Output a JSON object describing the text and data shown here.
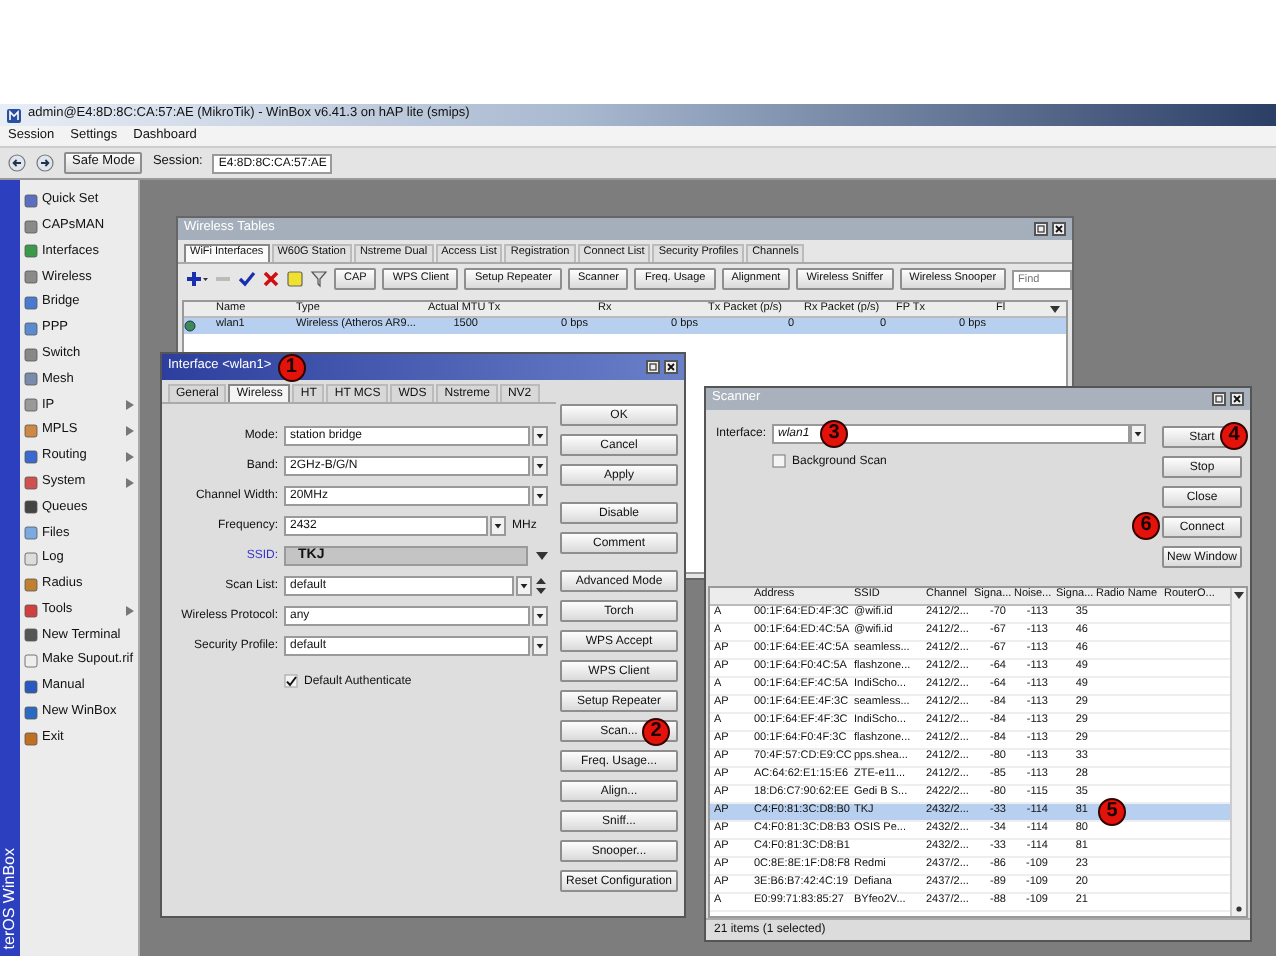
{
  "app_window": {
    "title": "admin@E4:8D:8C:CA:57:AE (MikroTik) - WinBox v6.41.3 on hAP lite (smips)"
  },
  "menu_bar": [
    "Session",
    "Settings",
    "Dashboard"
  ],
  "toolbar": {
    "safe_mode": "Safe Mode",
    "session_label": "Session:",
    "session_value": "E4:8D:8C:CA:57:AE"
  },
  "sidebar": {
    "brand": "terOS WinBox",
    "items": [
      {
        "label": "Quick Set",
        "submenu": false
      },
      {
        "label": "CAPsMAN",
        "submenu": false
      },
      {
        "label": "Interfaces",
        "submenu": false
      },
      {
        "label": "Wireless",
        "submenu": false
      },
      {
        "label": "Bridge",
        "submenu": false
      },
      {
        "label": "PPP",
        "submenu": false
      },
      {
        "label": "Switch",
        "submenu": false
      },
      {
        "label": "Mesh",
        "submenu": false
      },
      {
        "label": "IP",
        "submenu": true
      },
      {
        "label": "MPLS",
        "submenu": true
      },
      {
        "label": "Routing",
        "submenu": true
      },
      {
        "label": "System",
        "submenu": true
      },
      {
        "label": "Queues",
        "submenu": false
      },
      {
        "label": "Files",
        "submenu": false
      },
      {
        "label": "Log",
        "submenu": false
      },
      {
        "label": "Radius",
        "submenu": false
      },
      {
        "label": "Tools",
        "submenu": true
      },
      {
        "label": "New Terminal",
        "submenu": false
      },
      {
        "label": "Make Supout.rif",
        "submenu": false
      },
      {
        "label": "Manual",
        "submenu": false
      },
      {
        "label": "New WinBox",
        "submenu": false
      },
      {
        "label": "Exit",
        "submenu": false
      }
    ]
  },
  "wireless_tables": {
    "title": "Wireless Tables",
    "tabs": [
      {
        "label": "WiFi Interfaces",
        "selected": true
      },
      {
        "label": "W60G Station",
        "selected": false
      },
      {
        "label": "Nstreme Dual",
        "selected": false
      },
      {
        "label": "Access List",
        "selected": false
      },
      {
        "label": "Registration",
        "selected": false
      },
      {
        "label": "Connect List",
        "selected": false
      },
      {
        "label": "Security Profiles",
        "selected": false
      },
      {
        "label": "Channels",
        "selected": false
      }
    ],
    "tool_buttons": [
      "CAP",
      "WPS Client",
      "Setup Repeater",
      "Scanner",
      "Freq. Usage",
      "Alignment",
      "Wireless Sniffer",
      "Wireless Snooper"
    ],
    "find_placeholder": "Find",
    "columns": [
      "Name",
      "Type",
      "Actual MTU",
      "Tx",
      "Rx",
      "Tx Packet (p/s)",
      "Rx Packet (p/s)",
      "FP Tx",
      "Fl"
    ],
    "rows": [
      {
        "cells": [
          "wlan1",
          "Wireless (Atheros AR9...",
          "1500",
          "0 bps",
          "0 bps",
          "0",
          "0",
          "0 bps"
        ],
        "selected": true
      }
    ]
  },
  "interface_dialog": {
    "title": "Interface <wlan1>",
    "title_badge": "1",
    "tabs": [
      {
        "label": "General",
        "selected": false
      },
      {
        "label": "Wireless",
        "selected": true
      },
      {
        "label": "HT",
        "selected": false
      },
      {
        "label": "HT MCS",
        "selected": false
      },
      {
        "label": "WDS",
        "selected": false
      },
      {
        "label": "Nstreme",
        "selected": false
      },
      {
        "label": "NV2",
        "selected": false
      }
    ],
    "fields": [
      {
        "kind": "select",
        "label": "Mode:",
        "value": "station bridge"
      },
      {
        "kind": "select",
        "label": "Band:",
        "value": "2GHz-B/G/N"
      },
      {
        "kind": "select",
        "label": "Channel Width:",
        "value": "20MHz"
      },
      {
        "kind": "unit",
        "label": "Frequency:",
        "value": "2432",
        "unit": "MHz"
      },
      {
        "kind": "ssid",
        "label": "SSID:",
        "value": "TKJ"
      },
      {
        "kind": "list",
        "label": "Scan List:",
        "value": "default"
      },
      {
        "kind": "select",
        "label": "Wireless Protocol:",
        "value": "any"
      },
      {
        "kind": "select",
        "label": "Security Profile:",
        "value": "default"
      }
    ],
    "default_authenticate": {
      "label": "Default Authenticate",
      "checked": true
    },
    "button_groups": [
      [
        {
          "label": "OK"
        },
        {
          "label": "Cancel"
        },
        {
          "label": "Apply"
        }
      ],
      [
        {
          "label": "Disable"
        },
        {
          "label": "Comment"
        }
      ],
      [
        {
          "label": "Advanced Mode"
        },
        {
          "label": "Torch"
        },
        {
          "label": "WPS Accept"
        },
        {
          "label": "WPS Client"
        },
        {
          "label": "Setup Repeater"
        },
        {
          "label": "Scan...",
          "badge": "2"
        },
        {
          "label": "Freq. Usage..."
        },
        {
          "label": "Align..."
        },
        {
          "label": "Sniff..."
        },
        {
          "label": "Snooper..."
        },
        {
          "label": "Reset Configuration"
        }
      ]
    ]
  },
  "scanner": {
    "title": "Scanner",
    "interface_label": "Interface:",
    "interface_value": "wlan1",
    "interface_badge": "3",
    "background_scan": {
      "label": "Background Scan",
      "checked": false
    },
    "buttons": [
      {
        "label": "Start",
        "badge": "4"
      },
      {
        "label": "Stop"
      },
      {
        "label": "Close"
      },
      {
        "label": "Connect",
        "badge": "6"
      },
      {
        "label": "New Window"
      }
    ],
    "columns": [
      "Address",
      "SSID",
      "Channel",
      "Signa...",
      "Noise...",
      "Signa...",
      "Radio Name",
      "RouterO..."
    ],
    "rows": [
      {
        "type": "A",
        "address": "00:1F:64:ED:4F:3C",
        "ssid": "@wifi.id",
        "channel": "2412/2...",
        "signal": "-70",
        "noise": "-113",
        "snr": "35",
        "selected": false
      },
      {
        "type": "A",
        "address": "00:1F:64:ED:4C:5A",
        "ssid": "@wifi.id",
        "channel": "2412/2...",
        "signal": "-67",
        "noise": "-113",
        "snr": "46",
        "selected": false
      },
      {
        "type": "AP",
        "address": "00:1F:64:EE:4C:5A",
        "ssid": "seamless...",
        "channel": "2412/2...",
        "signal": "-67",
        "noise": "-113",
        "snr": "46",
        "selected": false
      },
      {
        "type": "AP",
        "address": "00:1F:64:F0:4C:5A",
        "ssid": "flashzone...",
        "channel": "2412/2...",
        "signal": "-64",
        "noise": "-113",
        "snr": "49",
        "selected": false
      },
      {
        "type": "A",
        "address": "00:1F:64:EF:4C:5A",
        "ssid": "IndiScho...",
        "channel": "2412/2...",
        "signal": "-64",
        "noise": "-113",
        "snr": "49",
        "selected": false
      },
      {
        "type": "AP",
        "address": "00:1F:64:EE:4F:3C",
        "ssid": "seamless...",
        "channel": "2412/2...",
        "signal": "-84",
        "noise": "-113",
        "snr": "29",
        "selected": false
      },
      {
        "type": "A",
        "address": "00:1F:64:EF:4F:3C",
        "ssid": "IndiScho...",
        "channel": "2412/2...",
        "signal": "-84",
        "noise": "-113",
        "snr": "29",
        "selected": false
      },
      {
        "type": "AP",
        "address": "00:1F:64:F0:4F:3C",
        "ssid": "flashzone...",
        "channel": "2412/2...",
        "signal": "-84",
        "noise": "-113",
        "snr": "29",
        "selected": false
      },
      {
        "type": "AP",
        "address": "70:4F:57:CD:E9:CC",
        "ssid": "pps.shea...",
        "channel": "2412/2...",
        "signal": "-80",
        "noise": "-113",
        "snr": "33",
        "selected": false
      },
      {
        "type": "AP",
        "address": "AC:64:62:E1:15:E6",
        "ssid": "ZTE-e11...",
        "channel": "2412/2...",
        "signal": "-85",
        "noise": "-113",
        "snr": "28",
        "selected": false
      },
      {
        "type": "AP",
        "address": "18:D6:C7:90:62:EE",
        "ssid": "Gedi B S...",
        "channel": "2422/2...",
        "signal": "-80",
        "noise": "-115",
        "snr": "35",
        "selected": false
      },
      {
        "type": "AP",
        "address": "C4:F0:81:3C:D8:B0",
        "ssid": "TKJ",
        "channel": "2432/2...",
        "signal": "-33",
        "noise": "-114",
        "snr": "81",
        "selected": true,
        "badge": "5"
      },
      {
        "type": "AP",
        "address": "C4:F0:81:3C:D8:B3",
        "ssid": "OSIS Pe...",
        "channel": "2432/2...",
        "signal": "-34",
        "noise": "-114",
        "snr": "80",
        "selected": false
      },
      {
        "type": "AP",
        "address": "C4:F0:81:3C:D8:B1",
        "channel": "2432/2...",
        "signal": "-33",
        "noise": "-114",
        "snr": "81",
        "selected": false
      },
      {
        "type": "AP",
        "address": "0C:8E:8E:1F:D8:F8",
        "ssid": "Redmi",
        "channel": "2437/2...",
        "signal": "-86",
        "noise": "-109",
        "snr": "23",
        "selected": false
      },
      {
        "type": "AP",
        "address": "3E:B6:B7:42:4C:19",
        "ssid": "Defiana",
        "channel": "2437/2...",
        "signal": "-89",
        "noise": "-109",
        "snr": "20",
        "selected": false
      },
      {
        "type": "A",
        "address": "E0:99:71:83:85:27",
        "ssid": "BYfeo2V...",
        "channel": "2437/2...",
        "signal": "-88",
        "noise": "-109",
        "snr": "21",
        "selected": false
      }
    ],
    "status": "21 items (1 selected)"
  }
}
